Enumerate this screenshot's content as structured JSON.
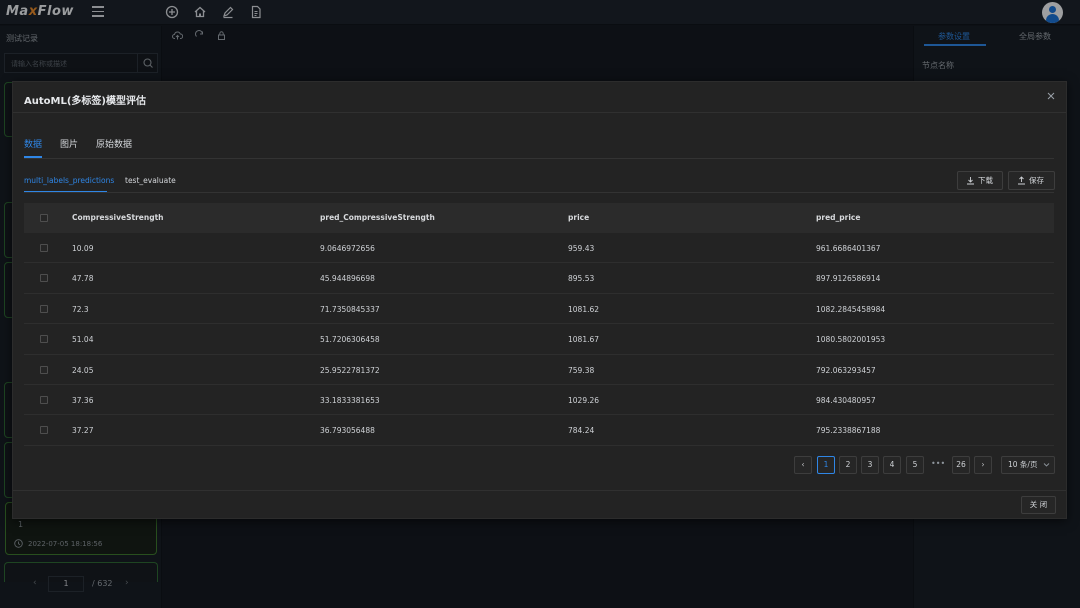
{
  "app": {
    "logo_main": "Ma",
    "logo_x": "x",
    "logo_rest": "Flow"
  },
  "left_panel": {
    "title": "测试记录",
    "search_placeholder": "请输入名称或描述",
    "record": {
      "index": "1",
      "date": "2022-07-05 18:18:56"
    },
    "pagination": {
      "current": "1",
      "total": "/ 632",
      "prev": "‹",
      "next": "›"
    }
  },
  "right_panel": {
    "tabs": [
      "参数设置",
      "全局参数"
    ],
    "node_name_label": "节点名称"
  },
  "modal": {
    "title": "AutoML(多标签)模型评估",
    "tabs": [
      "数据",
      "图片",
      "原始数据"
    ],
    "subtabs": [
      "multi_labels_predictions",
      "test_evaluate"
    ],
    "download_label": "下载",
    "save_label": "保存",
    "close_label": "关 闭",
    "table": {
      "columns": [
        "CompressiveStrength",
        "pred_CompressiveStrength",
        "price",
        "pred_price"
      ],
      "rows": [
        [
          "10.09",
          "9.0646972656",
          "959.43",
          "961.6686401367"
        ],
        [
          "47.78",
          "45.944896698",
          "895.53",
          "897.9126586914"
        ],
        [
          "72.3",
          "71.7350845337",
          "1081.62",
          "1082.2845458984"
        ],
        [
          "51.04",
          "51.7206306458",
          "1081.67",
          "1080.5802001953"
        ],
        [
          "24.05",
          "25.9522781372",
          "759.38",
          "792.063293457"
        ],
        [
          "37.36",
          "33.1833381653",
          "1029.26",
          "984.430480957"
        ],
        [
          "37.27",
          "36.793056488",
          "784.24",
          "795.2338867188"
        ]
      ]
    },
    "pagination": {
      "prev": "‹",
      "pages": [
        "1",
        "2",
        "3",
        "4",
        "5"
      ],
      "ellipsis": "•••",
      "last": "26",
      "next": "›",
      "page_size": "10 条/页",
      "current": "1"
    }
  },
  "colors": {
    "accent": "#2f86e6",
    "logo_x": "#e98a2b"
  }
}
